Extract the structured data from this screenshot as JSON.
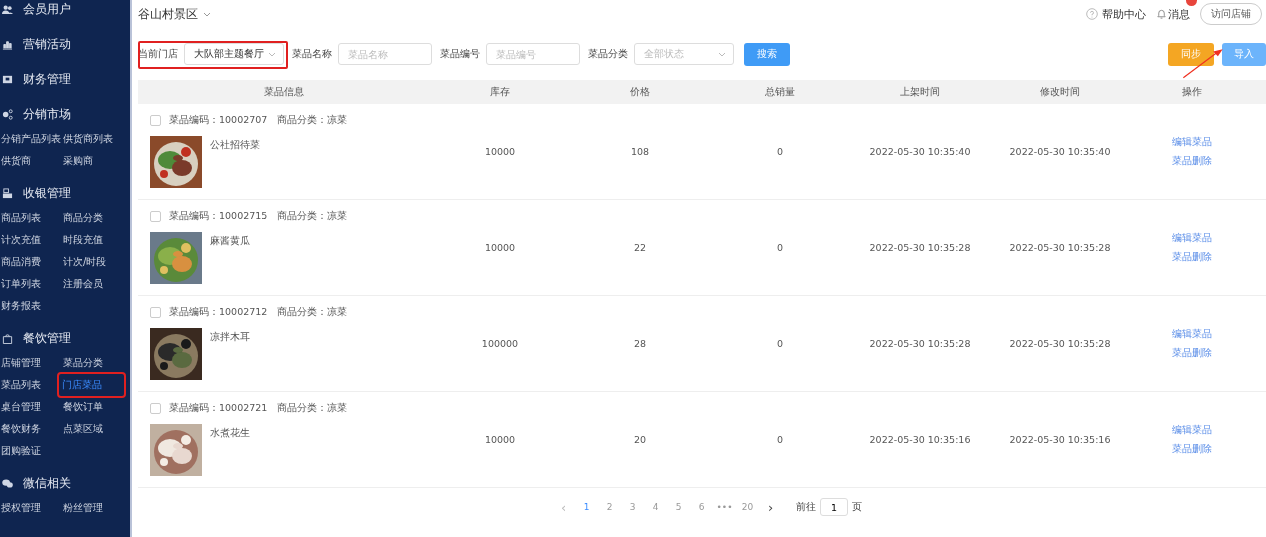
{
  "sidebar": {
    "sections": [
      {
        "title": "会员用户"
      },
      {
        "title": "营销活动"
      },
      {
        "title": "财务管理"
      },
      {
        "title": "分销市场",
        "items": [
          {
            "label": "分销产品列表",
            "selected": false
          },
          {
            "label": "供货商列表",
            "selected": false
          },
          {
            "label": "供货商",
            "selected": false
          },
          {
            "label": "采购商",
            "selected": false
          }
        ]
      },
      {
        "title": "收银管理",
        "items": [
          {
            "label": "商品列表",
            "selected": false
          },
          {
            "label": "商品分类",
            "selected": false
          },
          {
            "label": "计次充值",
            "selected": false
          },
          {
            "label": "时段充值",
            "selected": false
          },
          {
            "label": "商品消费",
            "selected": false
          },
          {
            "label": "计次/时段",
            "selected": false
          },
          {
            "label": "订单列表",
            "selected": false
          },
          {
            "label": "注册会员",
            "selected": false
          },
          {
            "label": "财务报表",
            "selected": false
          }
        ]
      },
      {
        "title": "餐饮管理",
        "items": [
          {
            "label": "店铺管理",
            "selected": false
          },
          {
            "label": "菜品分类",
            "selected": false
          },
          {
            "label": "菜品列表",
            "selected": false
          },
          {
            "label": "门店菜品",
            "selected": true
          },
          {
            "label": "桌台管理",
            "selected": false
          },
          {
            "label": "餐饮订单",
            "selected": false
          },
          {
            "label": "餐饮财务",
            "selected": false
          },
          {
            "label": "点菜区域",
            "selected": false
          },
          {
            "label": "团购验证",
            "selected": false
          }
        ]
      },
      {
        "title": "微信相关",
        "items": [
          {
            "label": "授权管理",
            "selected": false
          },
          {
            "label": "粉丝管理",
            "selected": false
          }
        ]
      }
    ]
  },
  "header": {
    "site": "谷山村景区",
    "help": "帮助中心",
    "messages": "消息",
    "visit": "访问店铺"
  },
  "filters": [
    {
      "kind": "select",
      "label": "当前门店",
      "value": "大队部主题餐厅"
    },
    {
      "kind": "input",
      "label": "菜品名称",
      "placeholder": "菜品名称"
    },
    {
      "kind": "input",
      "label": "菜品编号",
      "placeholder": "菜品编号"
    },
    {
      "kind": "select",
      "label": "菜品分类",
      "placeholder": "全部状态"
    }
  ],
  "search_button": "搜索",
  "sync_button": "同步",
  "import_button": "导入",
  "table": {
    "columns": [
      "菜品信息",
      "库存",
      "价格",
      "总销量",
      "上架时间",
      "修改时间",
      "操作"
    ],
    "rows": [
      {
        "checked": false,
        "code_text": "菜品编码：10002707",
        "category_text": "商品分类：凉菜",
        "name": "公社招待菜",
        "stock": "10000",
        "price": "108",
        "sales": "0",
        "listed": "2022-05-30 10:35:40",
        "modified": "2022-05-30 10:35:40",
        "actions": [
          "编辑菜品",
          "菜品删除"
        ]
      },
      {
        "checked": false,
        "code_text": "菜品编码：10002715",
        "category_text": "商品分类：凉菜",
        "name": "麻酱黄瓜",
        "stock": "10000",
        "price": "22",
        "sales": "0",
        "listed": "2022-05-30 10:35:28",
        "modified": "2022-05-30 10:35:28",
        "actions": [
          "编辑菜品",
          "菜品删除"
        ]
      },
      {
        "checked": false,
        "code_text": "菜品编码：10002712",
        "category_text": "商品分类：凉菜",
        "name": "凉拌木耳",
        "stock": "100000",
        "price": "28",
        "sales": "0",
        "listed": "2022-05-30 10:35:28",
        "modified": "2022-05-30 10:35:28",
        "actions": [
          "编辑菜品",
          "菜品删除"
        ]
      },
      {
        "checked": false,
        "code_text": "菜品编码：10002721",
        "category_text": "商品分类：凉菜",
        "name": "水煮花生",
        "stock": "10000",
        "price": "20",
        "sales": "0",
        "listed": "2022-05-30 10:35:16",
        "modified": "2022-05-30 10:35:16",
        "actions": [
          "编辑菜品",
          "菜品删除"
        ]
      }
    ]
  },
  "pagination": {
    "prev": "‹",
    "pages": [
      {
        "label": "1",
        "selected": true
      },
      {
        "label": "2",
        "selected": false
      },
      {
        "label": "3",
        "selected": false
      },
      {
        "label": "4",
        "selected": false
      },
      {
        "label": "5",
        "selected": false
      },
      {
        "label": "6",
        "selected": false
      },
      {
        "label": "•••",
        "selected": false
      },
      {
        "label": "20",
        "selected": false
      }
    ],
    "next": "›",
    "goto_label": "前往",
    "goto_value": "1",
    "page_unit": "页"
  }
}
